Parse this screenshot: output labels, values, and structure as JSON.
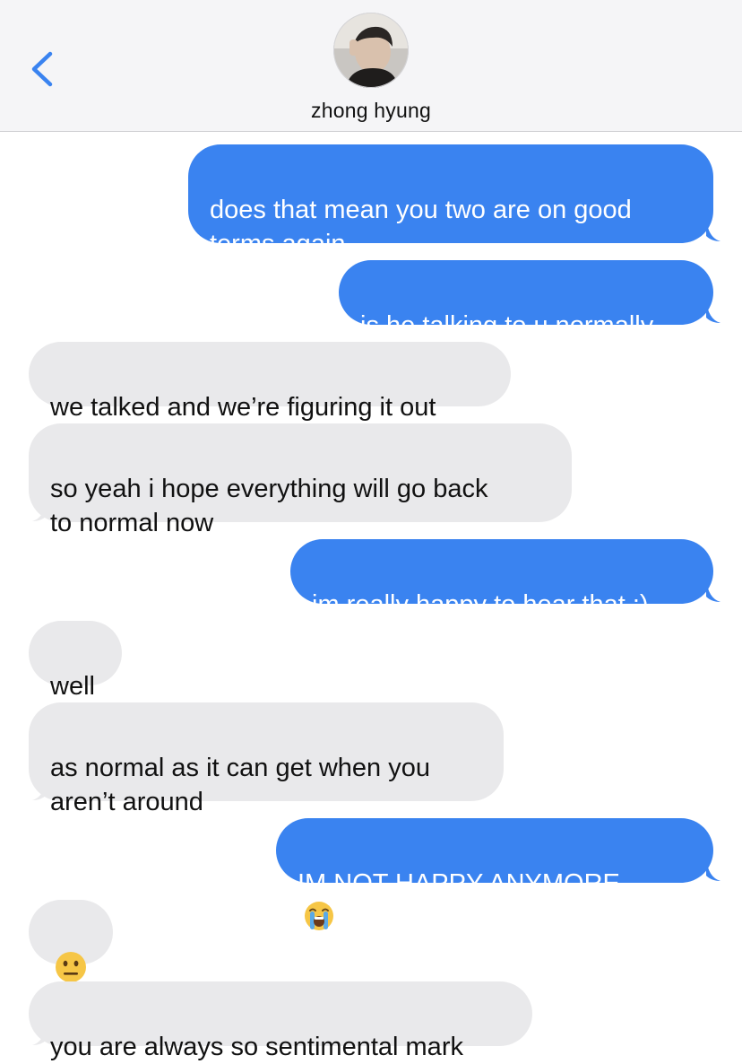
{
  "header": {
    "contact_name": "zhong hyung",
    "back_icon": "chevron-left-icon",
    "avatar": "contact-avatar-photo"
  },
  "messages": [
    {
      "side": "sent",
      "text": "does that mean you two are on good\nterms again"
    },
    {
      "side": "sent",
      "text": "is he talking to u normally"
    },
    {
      "side": "received",
      "text": "we talked and we’re figuring it out"
    },
    {
      "side": "received",
      "text": "so yeah i hope everything will go back\nto normal now"
    },
    {
      "side": "sent",
      "text": "im really happy to hear that :)"
    },
    {
      "side": "received",
      "text": "well"
    },
    {
      "side": "received",
      "text": "as normal as it can get when you\naren’t around"
    },
    {
      "side": "sent",
      "text": "IM NOT HAPPY ANYMORE",
      "emoji": "loudly-crying-face-icon"
    },
    {
      "side": "received",
      "text": "",
      "emoji": "neutral-face-icon"
    },
    {
      "side": "received",
      "text": "you are always so sentimental mark"
    }
  ],
  "colors": {
    "sent_bubble": "#3a83f0",
    "received_bubble": "#e9e9eb",
    "accent": "#3a83f0"
  }
}
